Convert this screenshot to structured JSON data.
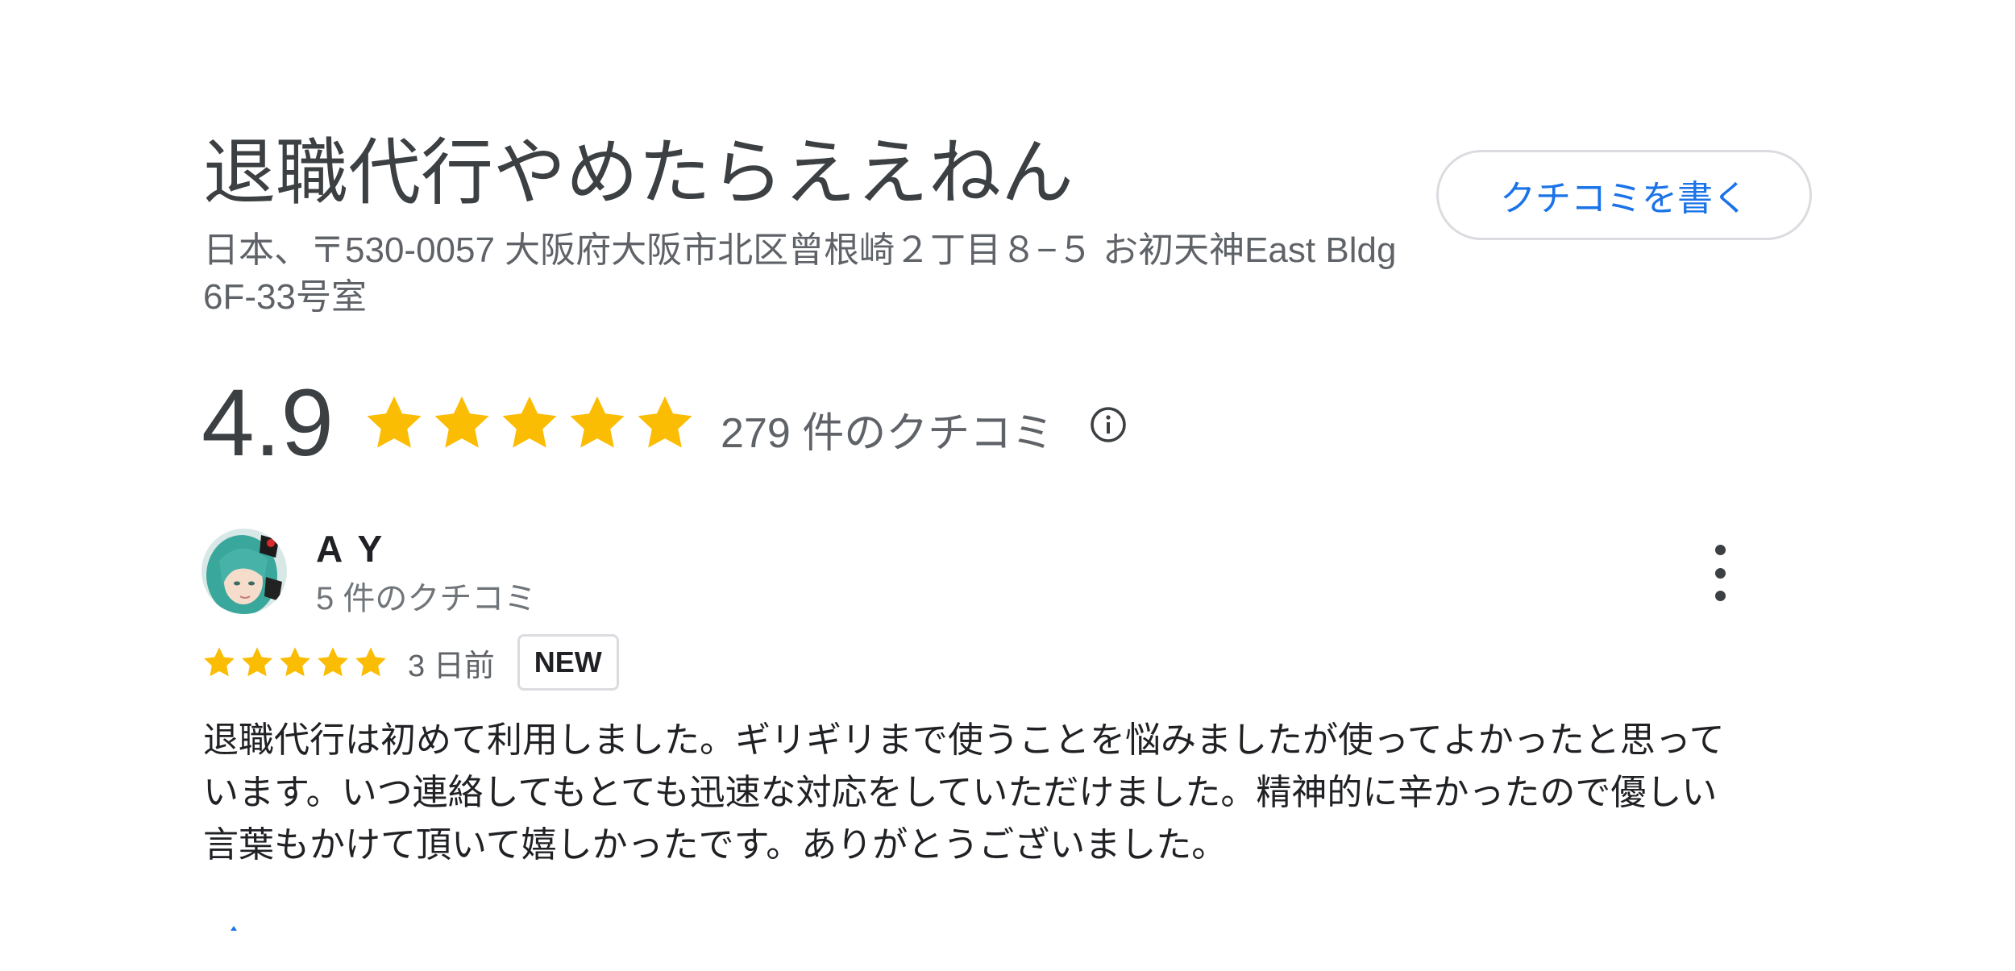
{
  "business": {
    "name": "退職代行やめたらええねん",
    "address": "日本、〒530-0057 大阪府大阪市北区曾根崎２丁目８−５ お初天神East Bldg 6F-33号室",
    "write_review_label": "クチコミを書く"
  },
  "rating": {
    "score": "4.9",
    "stars": 5,
    "review_count_label": "279 件のクチコミ"
  },
  "review": {
    "author": "A Y",
    "author_review_count": "5 件のクチコミ",
    "stars": 5,
    "date": "3 日前",
    "badge": "NEW",
    "text": "退職代行は初めて利用しました。ギリギリまで使うことを悩みましたが使ってよかったと思っています。いつ連絡してもとても迅速な対応をしていただけました。精神的に辛かったので優しい言葉もかけて頂いて嬉しかったです。ありがとうございました。"
  },
  "colors": {
    "star": "#fbbc04",
    "accent": "#1a73e8",
    "text_primary": "#202124",
    "text_secondary": "#5f6368",
    "border": "#dadce0"
  },
  "icons": {
    "info": "info-icon",
    "more": "more-vert-icon",
    "star": "star-icon"
  }
}
